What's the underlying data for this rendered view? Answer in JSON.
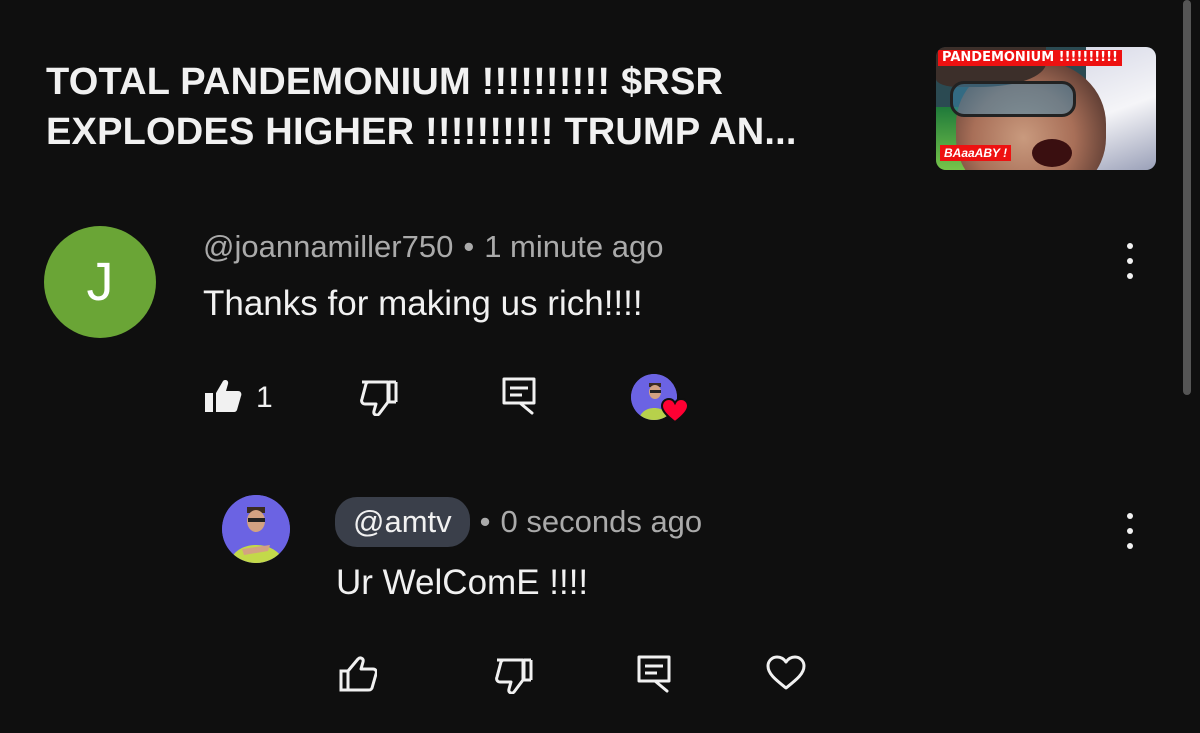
{
  "video": {
    "title_line1": "TOTAL PANDEMONIUM !!!!!!!!!! $RSR",
    "title_line2": "EXPLODES HIGHER !!!!!!!!!! TRUMP AN...",
    "thumbnail": {
      "banner_text": "PANDEMONIUM !!!!!!!!!!",
      "tag_text": "BAaaABY !"
    }
  },
  "comment": {
    "avatar_letter": "J",
    "author": "@joannamiller750",
    "separator": "•",
    "time": "1 minute ago",
    "text": "Thanks for making us rich!!!!",
    "like_count": "1",
    "icons": {
      "like": "thumbs-up-filled-icon",
      "dislike": "thumbs-down-icon",
      "reply": "reply-icon",
      "hearted_by_creator": "creator-heart-icon"
    }
  },
  "reply": {
    "author": "@amtv",
    "separator": "•",
    "time": "0 seconds ago",
    "text": "Ur WelComE !!!!",
    "icons": {
      "like": "thumbs-up-outline-icon",
      "dislike": "thumbs-down-icon",
      "reply": "reply-icon",
      "heart": "heart-outline-icon"
    }
  },
  "colors": {
    "background": "#0f0f0f",
    "text_primary": "#f1f1f1",
    "text_secondary": "#aaaaaa",
    "avatar_j": "#6aa536",
    "author_pill": "#3a3f4a",
    "heart": "#ff0033"
  }
}
